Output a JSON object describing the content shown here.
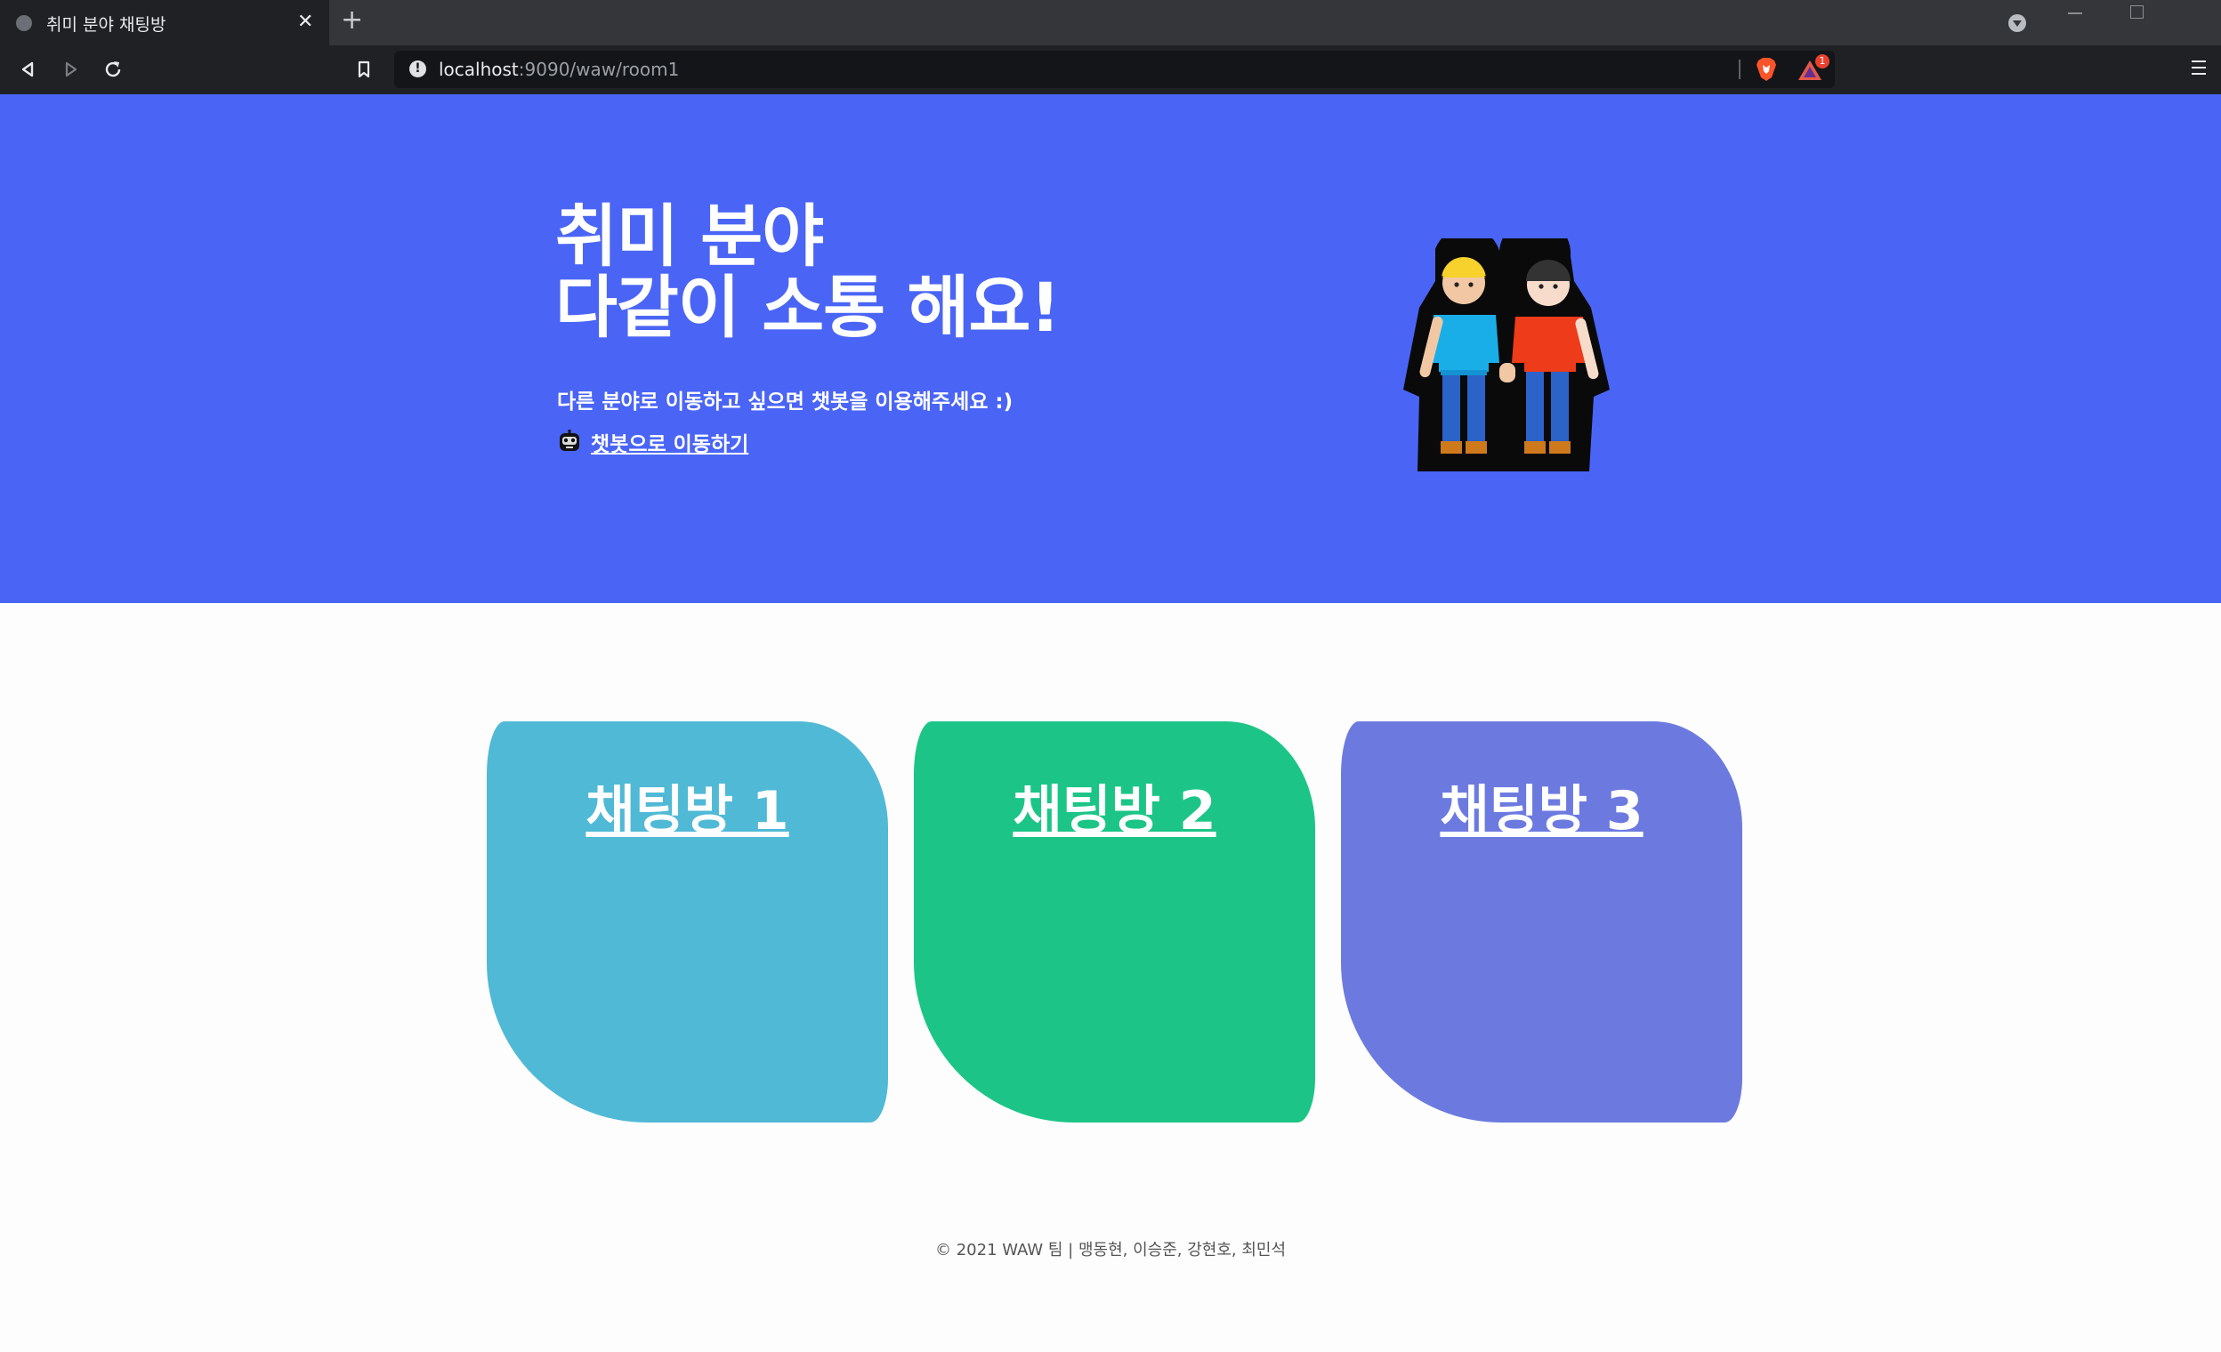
{
  "browser": {
    "tab_title": "취미 분야 채팅방",
    "new_tab_icon": "plus-icon",
    "url_host": "localhost",
    "url_path": ":9090/waw/room1",
    "rewards_badge": "1"
  },
  "hero": {
    "title_line1": "취미 분야",
    "title_line2": "다같이 소통 해요!",
    "subtitle": "다른 분야로 이동하고 싶으면 챗봇을 이용해주세요 :)",
    "chatbot_link": "챗봇으로 이동하기",
    "background_color": "#4a65f5"
  },
  "rooms": [
    {
      "label": "채팅방 1",
      "color": "#50b9d6"
    },
    {
      "label": "채팅방 2",
      "color": "#1cc587"
    },
    {
      "label": "채팅방 3",
      "color": "#6c7ae0"
    }
  ],
  "footer": {
    "text": "© 2021 WAW 팀 | 맹동현, 이승준, 강현호, 최민석"
  }
}
